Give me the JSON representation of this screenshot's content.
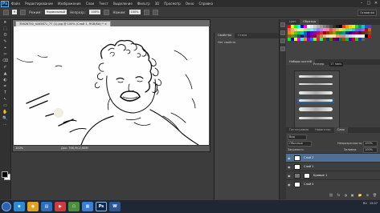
{
  "app": {
    "logo": "Ps"
  },
  "menu": [
    "Файл",
    "Редактирование",
    "Изображение",
    "Слои",
    "Текст",
    "Выделение",
    "Фильтр",
    "3D",
    "Просмотр",
    "Окно",
    "Справка"
  ],
  "window_controls": [
    "–",
    "□",
    "✕"
  ],
  "options": {
    "size_value": "9",
    "mode_label": "Режим:",
    "mode_value": "Нормальный",
    "opacity_label": "Непрозр.:",
    "opacity_value": "100%",
    "flow_label": "Нажим:",
    "flow_value": "100%",
    "workspace": "Основная"
  },
  "tools": [
    "➤",
    "⬚",
    "ʘ",
    "✎",
    "⌖",
    "✂",
    "⌫",
    "✐",
    "▲",
    "◐",
    "✒",
    "T",
    "↖",
    "▭",
    "✋",
    "🔍",
    "⋯"
  ],
  "document": {
    "tab_label": "35628750_4445871_77 (1).jpg @ 100% (Слой 1, RGB/8#) *",
    "tab_close": "×",
    "zoom": "100%",
    "doc_info": "Док: 766,9K/2,68M"
  },
  "mid_panel": {
    "tabs": [
      "Свойства",
      "Стили"
    ],
    "content_label": "Нет свойств"
  },
  "swatches": {
    "tabs": [
      "Цвет",
      "Образцы"
    ],
    "colors": [
      "#ff0000",
      "#ffff00",
      "#00ff00",
      "#00ffff",
      "#0000ff",
      "#ff00ff",
      "#ffffff",
      "#e6e6e6",
      "#cccccc",
      "#b3b3b3",
      "#999999",
      "#808080",
      "#666666",
      "#4d4d4d",
      "#333333",
      "#1a1a1a",
      "#000000",
      "#ff3300",
      "#ff9900",
      "#ffcc00",
      "#ccff00",
      "#33cc33",
      "#009966",
      "#00cccc",
      "#0066cc",
      "#6633cc",
      "#ff5e5e",
      "#ffa07a",
      "#ffd27f",
      "#fff27f",
      "#d7ff7f",
      "#a3e87f",
      "#7fe8b8",
      "#7fe8e8",
      "#7fb8ff",
      "#8f7fff",
      "#c07fff",
      "#ff7fd5",
      "#ff7f9f",
      "#e05555",
      "#e08a55",
      "#e0b355",
      "#e0e055",
      "#aee055",
      "#55e07a",
      "#55e0c0",
      "#55b3e0",
      "#5578e0",
      "#7a55e0",
      "#b355e0",
      "#cc0000",
      "#cc6600",
      "#cc9900",
      "#cccc00",
      "#66cc00",
      "#00cc66",
      "#00cccc",
      "#0066cc",
      "#3300cc",
      "#6600cc",
      "#990099",
      "#cc0066",
      "#cc3333",
      "#990000",
      "#993300",
      "#996600",
      "#999900",
      "#339900",
      "#009933",
      "#009999",
      "#003399",
      "#330099",
      "#660099",
      "#990066",
      "#660033",
      "#663300",
      "#5c4033",
      "#7a5230",
      "#8b6914",
      "#6b8e23",
      "#2e8b57",
      "#2f4f4f",
      "#191970",
      "#483d8b",
      "#4b0082",
      "#800080",
      "#8b0040",
      "#a0522d",
      "#cd853f",
      "#deb887",
      "#f5deb3",
      "#ffe4c4",
      "#ffdab9",
      "#e9967a",
      "#f08080",
      "#bc8f8f",
      "#c0c0c0",
      "#d3d3d3",
      "#dcdcdc",
      "#f0f0f0",
      "#fafafa",
      "#ffffff",
      "#000000",
      "#ff0000",
      "#00ff00",
      "#0000ff",
      "#ffff00",
      "#ff00ff",
      "#00ffff",
      "#ff8000",
      "#8000ff",
      "#0080ff",
      "#80ff00",
      "#ff0080",
      "#00ff80",
      "#804000",
      "#004080",
      "#408000",
      "#800040",
      "#400080",
      "#008040",
      "#c04000",
      "#00c040",
      "#4000c0",
      "#c00040",
      "#40c000",
      "#0040c0",
      "#606060"
    ]
  },
  "brushes": {
    "tabs": [
      "Наборы кистей"
    ],
    "size_label": "Размер:",
    "size_value": "17 пикс.",
    "bottom_tabs": [
      "Гистограмма",
      "Навигатор",
      "Слои"
    ]
  },
  "layers": {
    "tabs": [
      "Слои",
      "Каналы",
      "Контуры"
    ],
    "kind_label": "Вид",
    "blend_mode": "Обычные",
    "opacity_label": "Непрозрачность:",
    "opacity_value": "100%",
    "lock_label": "Закрепить:",
    "fill_label": "Заливка:",
    "fill_value": "100%",
    "rows": [
      {
        "name": "Слой 2",
        "active": true,
        "mask": false
      },
      {
        "name": "Слой 1",
        "active": false,
        "mask": false
      },
      {
        "name": "Кривые 1",
        "active": false,
        "mask": true
      },
      {
        "name": "Слой 0",
        "active": false,
        "mask": false
      }
    ],
    "eye": "◉",
    "footer_icons": [
      "⛓",
      "fx",
      "◑",
      "▣",
      "📁",
      "⊞",
      "🗑"
    ]
  },
  "taskbar": {
    "apps": [
      {
        "label": "e",
        "color": "#2a8ad6"
      },
      {
        "label": "◉",
        "color": "#e0a020"
      },
      {
        "label": "▤",
        "color": "#2c6fbf"
      },
      {
        "label": "▶",
        "color": "#d23b3b"
      },
      {
        "label": "☖",
        "color": "#4a8f3a"
      },
      {
        "label": "▦",
        "color": "#3a7fd5"
      },
      {
        "label": "Ps",
        "color": "#0a2a4a"
      },
      {
        "label": "W",
        "color": "#2b5797"
      }
    ],
    "lang": "RU",
    "time": "15:07"
  }
}
